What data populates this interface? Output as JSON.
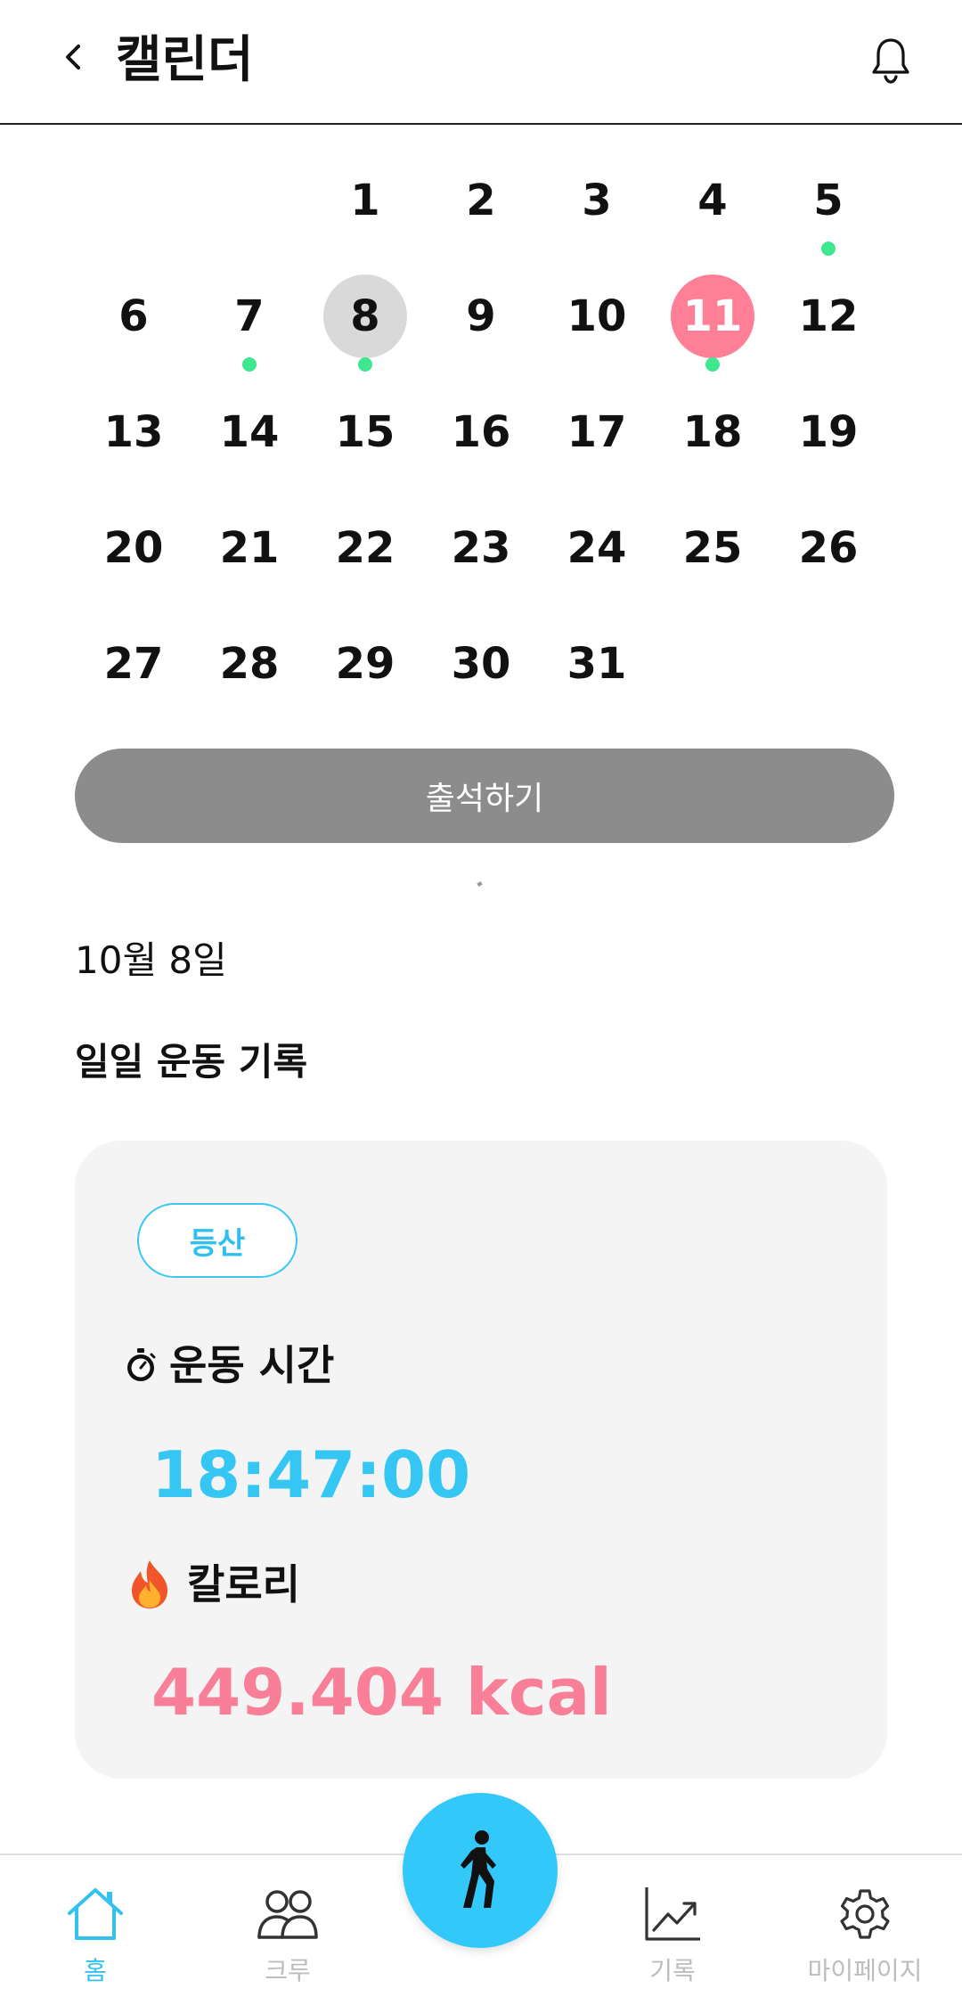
{
  "header": {
    "title": "캘린더",
    "back_icon": "chevron-left-icon",
    "bell_icon": "bell-icon"
  },
  "calendar": {
    "leading_blanks": 2,
    "days": [
      {
        "day": "1"
      },
      {
        "day": "2"
      },
      {
        "day": "3"
      },
      {
        "day": "4"
      },
      {
        "day": "5",
        "dot": true
      },
      {
        "day": "6"
      },
      {
        "day": "7",
        "dot": true
      },
      {
        "day": "8",
        "dot": true,
        "selected": true
      },
      {
        "day": "9"
      },
      {
        "day": "10"
      },
      {
        "day": "11",
        "dot": true,
        "today": true
      },
      {
        "day": "12"
      },
      {
        "day": "13"
      },
      {
        "day": "14"
      },
      {
        "day": "15"
      },
      {
        "day": "16"
      },
      {
        "day": "17"
      },
      {
        "day": "18"
      },
      {
        "day": "19"
      },
      {
        "day": "20"
      },
      {
        "day": "21"
      },
      {
        "day": "22"
      },
      {
        "day": "23"
      },
      {
        "day": "24"
      },
      {
        "day": "25"
      },
      {
        "day": "26"
      },
      {
        "day": "27"
      },
      {
        "day": "28"
      },
      {
        "day": "29"
      },
      {
        "day": "30"
      },
      {
        "day": "31"
      }
    ],
    "colors": {
      "selected_circle": "#d9d9d9",
      "today_circle": "#ff8096",
      "activity_dot": "#3ee88e"
    }
  },
  "attend_button": {
    "label": "출석하기",
    "color": "#8c8c8c"
  },
  "selected_date": "10월 8일",
  "section_title": "일일 운동 기록",
  "record": {
    "exercise_type": "등산",
    "time_label": "운동 시간",
    "time_icon": "stopwatch-icon",
    "time_value": "18:47:00",
    "calorie_label": "칼로리",
    "calorie_icon": "fire-icon",
    "calorie_value": "449.404 kcal",
    "colors": {
      "time": "#36c6f4",
      "calorie": "#f87f97",
      "tag": "#30c0ef"
    }
  },
  "bottom_nav": {
    "items": [
      {
        "label": "홈",
        "icon": "home-icon",
        "active": true
      },
      {
        "label": "크루",
        "icon": "people-icon"
      },
      {
        "label": "기록",
        "icon": "chart-line-icon"
      },
      {
        "label": "마이페이지",
        "icon": "gear-icon"
      }
    ],
    "fab_icon": "walking-person-icon",
    "active_color": "#33c2f0",
    "inactive_color": "#bdbdbd"
  }
}
